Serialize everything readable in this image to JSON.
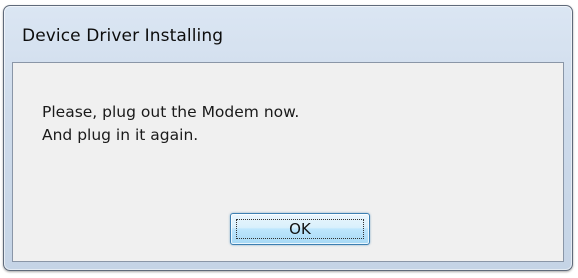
{
  "window": {
    "title": "Device Driver Installing"
  },
  "message": {
    "lines": [
      "Please, plug out the Modem now.",
      "And plug in it again."
    ]
  },
  "buttons": {
    "ok_label": "OK"
  }
}
